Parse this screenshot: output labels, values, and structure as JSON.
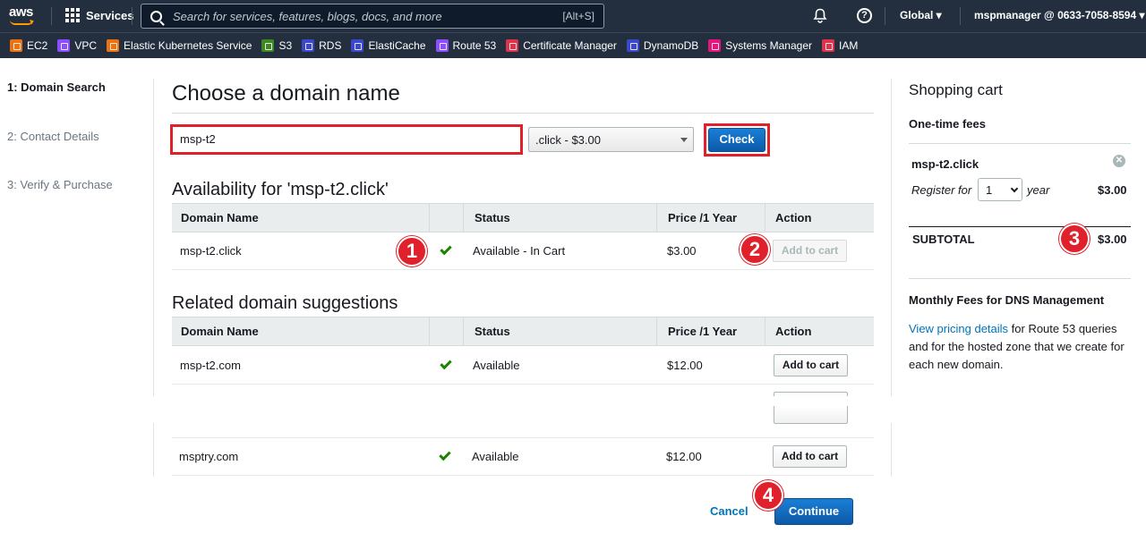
{
  "topbar": {
    "logo": "aws",
    "services_label": "Services",
    "search_placeholder": "Search for services, features, blogs, docs, and more",
    "search_shortcut": "[Alt+S]",
    "region": "Global ▾",
    "account": "mspmanager @ 0633-7058-8594 ▾"
  },
  "favorites": [
    {
      "label": "EC2",
      "color": "#ec7211"
    },
    {
      "label": "VPC",
      "color": "#8c4fff"
    },
    {
      "label": "Elastic Kubernetes Service",
      "color": "#ec7211"
    },
    {
      "label": "S3",
      "color": "#3f8624"
    },
    {
      "label": "RDS",
      "color": "#3b48cc"
    },
    {
      "label": "ElastiCache",
      "color": "#3b48cc"
    },
    {
      "label": "Route 53",
      "color": "#8c4fff"
    },
    {
      "label": "Certificate Manager",
      "color": "#dd344c"
    },
    {
      "label": "DynamoDB",
      "color": "#3b48cc"
    },
    {
      "label": "Systems Manager",
      "color": "#e7157b"
    },
    {
      "label": "IAM",
      "color": "#dd344c"
    }
  ],
  "steps": [
    {
      "label": "1: Domain Search",
      "active": true
    },
    {
      "label": "2: Contact Details",
      "active": false
    },
    {
      "label": "3: Verify & Purchase",
      "active": false
    }
  ],
  "main": {
    "title": "Choose a domain name",
    "domain_value": "msp-t2",
    "tld_selected": ".click - $3.00",
    "check_label": "Check",
    "availability_title": "Availability for 'msp-t2.click'",
    "columns": [
      "Domain Name",
      "Status",
      "Price /1 Year",
      "Action"
    ],
    "availability_row": {
      "domain": "msp-t2.click",
      "status": "Available - In Cart",
      "price": "$3.00",
      "action": "Add to cart"
    },
    "related_title": "Related domain suggestions",
    "related_rows": [
      {
        "domain": "msp-t2.com",
        "status": "Available",
        "price": "$12.00",
        "action": "Add to cart"
      },
      {
        "domain": "msptry.com",
        "status": "Available",
        "price": "$12.00",
        "action": "Add to cart"
      }
    ]
  },
  "cart": {
    "title": "Shopping cart",
    "one_time_fees": "One-time fees",
    "item_name": "msp-t2.click",
    "register_for": "Register for",
    "years": "1",
    "year_word": "year",
    "item_price": "$3.00",
    "subtotal_label": "SUBTOTAL",
    "subtotal_value": "$3.00",
    "monthly_title": "Monthly Fees for DNS Management",
    "pricing_link": "View pricing details",
    "monthly_text": " for Route 53 queries and for the hosted zone that we create for each new domain."
  },
  "footer": {
    "cancel_label": "Cancel",
    "continue_label": "Continue"
  },
  "annotations": [
    "1",
    "2",
    "3",
    "4"
  ]
}
